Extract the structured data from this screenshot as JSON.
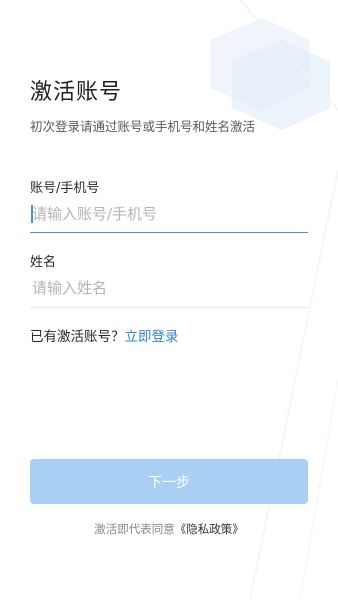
{
  "header": {
    "title": "激活账号",
    "subtitle": "初次登录请通过账号或手机号和姓名激活"
  },
  "form": {
    "account": {
      "label": "账号/手机号",
      "placeholder": "请输入账号/手机号",
      "value": ""
    },
    "name": {
      "label": "姓名",
      "placeholder": "请输入姓名",
      "value": ""
    }
  },
  "login_prompt": {
    "text": "已有激活账号？",
    "link": "立即登录"
  },
  "next_button": {
    "label": "下一步"
  },
  "agreement": {
    "text": "激活即代表同意",
    "policy_link": "《隐私政策》"
  },
  "colors": {
    "accent": "#3a9ad9",
    "link": "#2f86d1",
    "button_disabled": "#a9d0f3"
  }
}
